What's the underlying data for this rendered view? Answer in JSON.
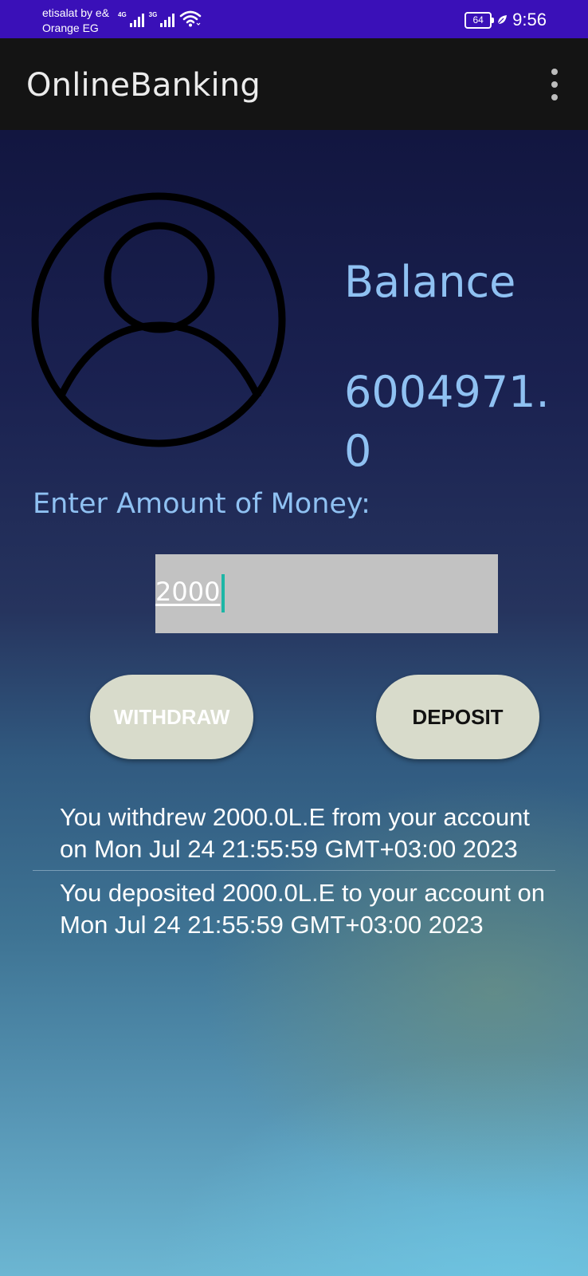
{
  "status_bar": {
    "carrier_line1": "etisalat by e&",
    "carrier_line2": "Orange EG",
    "network1": "4G",
    "network2": "3G",
    "battery": "64",
    "time": "9:56"
  },
  "app_bar": {
    "title": "OnlineBanking"
  },
  "account": {
    "balance_label": "Balance",
    "balance_value": "6004971.0"
  },
  "form": {
    "amount_label": "Enter Amount of Money:",
    "amount_value": "2000"
  },
  "buttons": {
    "withdraw": "WITHDRAW",
    "deposit": "DEPOSIT"
  },
  "history": [
    "You withdrew 2000.0L.E from your account on Mon Jul 24 21:55:59 GMT+03:00 2023",
    "You deposited 2000.0L.E to your account on Mon Jul 24 21:55:59 GMT+03:00 2023"
  ],
  "colors": {
    "status_bar": "#3a10b8",
    "app_bar": "#141414",
    "accent_text": "#8fc1f2",
    "button_bg": "#d8dbcb",
    "input_bg": "#c2c2c2",
    "caret": "#1db6a6"
  }
}
